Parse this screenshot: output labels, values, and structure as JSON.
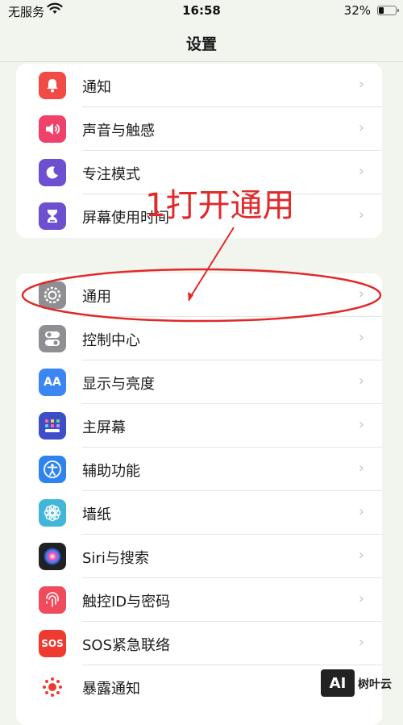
{
  "status_bar": {
    "carrier": "无服务",
    "wifi_icon": "wifi-icon",
    "time": "16:58",
    "battery_percent": "32%",
    "battery_level": 0.32
  },
  "nav": {
    "title": "设置"
  },
  "group1": [
    {
      "label": "通知",
      "icon": "bell-icon",
      "color": "#f04b45"
    },
    {
      "label": "声音与触感",
      "icon": "speaker-icon",
      "color": "#f0416a"
    },
    {
      "label": "专注模式",
      "icon": "moon-icon",
      "color": "#6c50cf"
    },
    {
      "label": "屏幕使用时间",
      "icon": "hourglass-icon",
      "color": "#6c50cf"
    }
  ],
  "group2": [
    {
      "label": "通用",
      "icon": "gear-icon",
      "color": "#8e8e93"
    },
    {
      "label": "控制中心",
      "icon": "toggle-icon",
      "color": "#8e8e93"
    },
    {
      "label": "显示与亮度",
      "icon": "text-size-icon",
      "color": "#3b86f3",
      "glyph": "AA"
    },
    {
      "label": "主屏幕",
      "icon": "home-grid-icon",
      "color": "#3e4ec9"
    },
    {
      "label": "辅助功能",
      "icon": "accessibility-icon",
      "color": "#2f83ef"
    },
    {
      "label": "墙纸",
      "icon": "flower-icon",
      "color": "#41b6d8"
    },
    {
      "label": "Siri与搜索",
      "icon": "siri-icon",
      "color": "#222222"
    },
    {
      "label": "触控ID与密码",
      "icon": "fingerprint-icon",
      "color": "#f04b5d"
    },
    {
      "label": "SOS紧急联络",
      "icon": "sos-icon",
      "color": "#ef3b2f",
      "glyph": "SOS"
    },
    {
      "label": "暴露通知",
      "icon": "exposure-icon",
      "color": "#ffffff"
    }
  ],
  "annotation": {
    "text": "1打开通用",
    "color": "#e02a2a"
  },
  "watermark": {
    "logo": "AI",
    "text": "树叶云"
  }
}
